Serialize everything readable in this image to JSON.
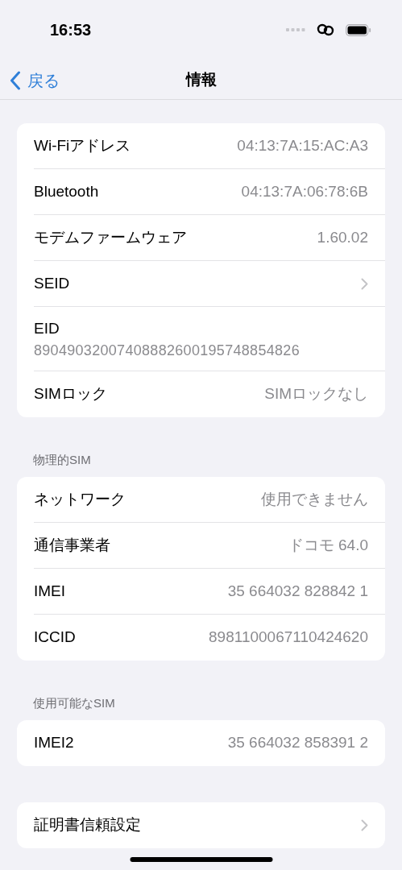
{
  "status_bar": {
    "time": "16:53"
  },
  "nav": {
    "back": "戻る",
    "title": "情報"
  },
  "sections": [
    {
      "rows": [
        {
          "kind": "value",
          "label": "Wi-Fiアドレス",
          "value": "04:13:7A:15:AC:A3"
        },
        {
          "kind": "value",
          "label": "Bluetooth",
          "value": "04:13:7A:06:78:6B"
        },
        {
          "kind": "value",
          "label": "モデムファームウェア",
          "value": "1.60.02"
        },
        {
          "kind": "chevron",
          "label": "SEID"
        },
        {
          "kind": "stacked",
          "label": "EID",
          "value": "89049032007408882600195748854826"
        },
        {
          "kind": "value",
          "label": "SIMロック",
          "value": "SIMロックなし"
        }
      ]
    },
    {
      "header": "物理的SIM",
      "rows": [
        {
          "kind": "value",
          "label": "ネットワーク",
          "value": "使用できません"
        },
        {
          "kind": "value",
          "label": "通信事業者",
          "value": "ドコモ 64.0"
        },
        {
          "kind": "value",
          "label": "IMEI",
          "value": "35 664032 828842 1"
        },
        {
          "kind": "value",
          "label": "ICCID",
          "value": "8981100067110424620"
        }
      ]
    },
    {
      "header": "使用可能なSIM",
      "rows": [
        {
          "kind": "value",
          "label": "IMEI2",
          "value": "35 664032 858391 2"
        }
      ]
    },
    {
      "rows": [
        {
          "kind": "chevron",
          "label": "証明書信頼設定"
        }
      ]
    }
  ]
}
